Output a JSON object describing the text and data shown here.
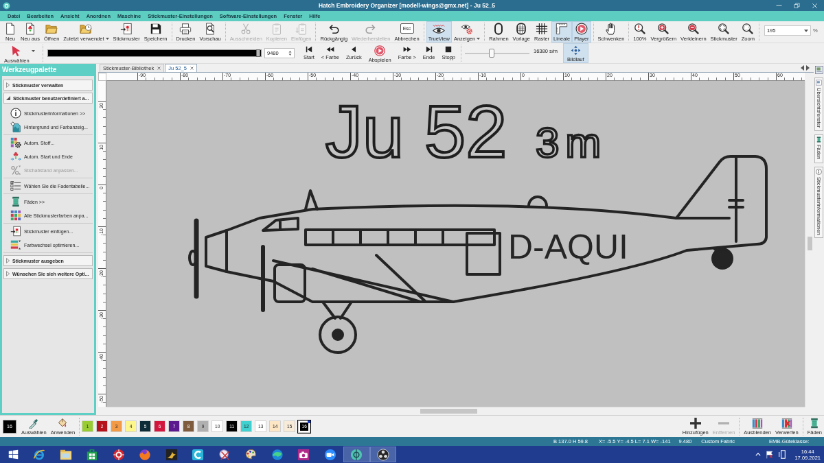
{
  "window": {
    "title": "Hatch Embroidery Organizer [modell-wings@gmx.net] - Ju 52_5"
  },
  "menu": [
    "Datei",
    "Bearbeiten",
    "Ansicht",
    "Anordnen",
    "Maschine",
    "Stickmuster-Einstellungen",
    "Software-Einstellungen",
    "Fenster",
    "Hilfe"
  ],
  "toolbar": {
    "groups": [
      {
        "buttons": [
          {
            "label": "Neu",
            "disabled": false,
            "on": false,
            "dropdown": false
          },
          {
            "label": "Neu aus",
            "disabled": false,
            "on": false,
            "dropdown": false
          },
          {
            "label": "Öffnen",
            "disabled": false,
            "on": false,
            "dropdown": false
          },
          {
            "label": "Zuletzt verwendet",
            "disabled": false,
            "on": false,
            "dropdown": true
          },
          {
            "label": "Stickmuster",
            "disabled": false,
            "on": false,
            "dropdown": false
          },
          {
            "label": "Speichern",
            "disabled": false,
            "on": false,
            "dropdown": false
          }
        ]
      },
      {
        "buttons": [
          {
            "label": "Drucken",
            "disabled": false,
            "on": false,
            "dropdown": false
          },
          {
            "label": "Vorschau",
            "disabled": false,
            "on": false,
            "dropdown": false
          }
        ]
      },
      {
        "buttons": [
          {
            "label": "Ausschneiden",
            "disabled": true,
            "on": false,
            "dropdown": false
          },
          {
            "label": "Kopieren",
            "disabled": true,
            "on": false,
            "dropdown": false
          },
          {
            "label": "Einfügen",
            "disabled": true,
            "on": false,
            "dropdown": false
          }
        ]
      },
      {
        "buttons": [
          {
            "label": "Rückgängig",
            "disabled": false,
            "on": false,
            "dropdown": false
          },
          {
            "label": "Wiederherstellen",
            "disabled": true,
            "on": false,
            "dropdown": false
          },
          {
            "label": "Abbrechen",
            "keycap": "Esc",
            "disabled": false,
            "on": false,
            "dropdown": false
          }
        ]
      },
      {
        "buttons": [
          {
            "label": "TrueView",
            "disabled": false,
            "on": true,
            "dropdown": false
          },
          {
            "label": "Anzeigen",
            "disabled": false,
            "on": false,
            "dropdown": true
          }
        ]
      },
      {
        "buttons": [
          {
            "label": "Rahmen",
            "disabled": false,
            "on": false,
            "dropdown": false
          },
          {
            "label": "Vorlage",
            "disabled": false,
            "on": false,
            "dropdown": false
          },
          {
            "label": "Raster",
            "disabled": false,
            "on": false,
            "dropdown": false
          },
          {
            "label": "Lineale",
            "disabled": false,
            "on": true,
            "dropdown": false
          },
          {
            "label": "Player",
            "disabled": false,
            "on": true,
            "dropdown": false
          }
        ]
      },
      {
        "buttons": [
          {
            "label": "Schwenken",
            "disabled": false,
            "on": false,
            "dropdown": false
          }
        ]
      },
      {
        "buttons": [
          {
            "label": "100%",
            "disabled": false,
            "on": false,
            "dropdown": false
          },
          {
            "label": "Vergrößern",
            "disabled": false,
            "on": false,
            "dropdown": false
          },
          {
            "label": "Verkleinern",
            "disabled": false,
            "on": false,
            "dropdown": false
          },
          {
            "label": "Stickmuster",
            "disabled": false,
            "on": false,
            "dropdown": false
          },
          {
            "label": "Zoom",
            "disabled": false,
            "on": false,
            "dropdown": false
          }
        ]
      }
    ],
    "zoom": {
      "value": "195",
      "unit": "%"
    }
  },
  "player_bar": {
    "select_tool": {
      "label": "Auswählen"
    },
    "stitch_slider": {
      "level": 1
    },
    "stitch_count": "9480",
    "controls": [
      "Start",
      "< Farbe",
      "Zurück",
      "Abspielen",
      "Farbe >",
      "Ende",
      "Stopp"
    ],
    "speed_slider": {
      "level": 0.41
    },
    "speed": "16380 s/m",
    "scroll_button": {
      "label": "Bildlauf",
      "on": true
    }
  },
  "tool_palette": {
    "title": "Werkzeugpalette",
    "sections": [
      {
        "label": "Stickmuster verwalten",
        "expanded": false
      },
      {
        "label": "Stickmuster benutzerdefiniert a...",
        "expanded": true,
        "groups": [
          {
            "items": [
              {
                "label": "Stickmusterinformationen >>",
                "disabled": false
              },
              {
                "label": "Hintergrund und Farbanzeig...",
                "disabled": false
              }
            ]
          },
          {
            "items": [
              {
                "label": "Autom. Stoff...",
                "disabled": false
              },
              {
                "label": "Autom. Start und Ende",
                "disabled": false
              },
              {
                "label": "Stichabstand anpassen...",
                "disabled": true
              }
            ]
          },
          {
            "items": [
              {
                "label": "Wählen Sie die Fadentabelle...",
                "disabled": false
              }
            ]
          },
          {
            "items": [
              {
                "label": "Fäden >>",
                "disabled": false
              },
              {
                "label": "Alle Stickmusterfarben anpa...",
                "disabled": false
              }
            ]
          },
          {
            "items": [
              {
                "label": "Stickmuster einfügen...",
                "disabled": false
              },
              {
                "label": "Farbwechsel optimieren...",
                "disabled": false
              }
            ]
          }
        ]
      },
      {
        "label": "Stickmuster ausgeben",
        "expanded": false
      },
      {
        "label": "Wünschen Sie sich weitere Opti...",
        "expanded": false
      }
    ]
  },
  "document_tabs": [
    {
      "label": "Stickmuster-Bibliothek",
      "selected": false
    },
    {
      "label": "Ju 52_5",
      "selected": true
    }
  ],
  "rulers": {
    "horizontal": [
      "-90",
      "-80",
      "-70",
      "-60",
      "-50",
      "-40",
      "-30",
      "-20",
      "-10",
      "0",
      "10",
      "20",
      "30",
      "40",
      "50",
      "60"
    ],
    "vertical": [
      "20",
      "10",
      "0",
      "-10",
      "-20",
      "-30",
      "-40",
      "-50"
    ]
  },
  "design": {
    "title": "Ju 52",
    "subtitle": "3m",
    "registration": "D-AQUI"
  },
  "side_tabs": [
    "Übersichtsfenster",
    "Fäden",
    "Stickmusterinformationen"
  ],
  "color_bar": {
    "current": "16",
    "tools": [
      "Auswählen",
      "Anwenden"
    ],
    "swatches": [
      {
        "label": "1",
        "color": "#99cc33",
        "selected": false
      },
      {
        "label": "2",
        "color": "#b5121b",
        "selected": false
      },
      {
        "label": "3",
        "color": "#f39a46",
        "selected": false
      },
      {
        "label": "4",
        "color": "#fdf68c",
        "selected": false
      },
      {
        "label": "5",
        "color": "#0e2c37",
        "selected": false
      },
      {
        "label": "6",
        "color": "#d3163e",
        "selected": false
      },
      {
        "label": "7",
        "color": "#5b1b8f",
        "selected": false
      },
      {
        "label": "8",
        "color": "#7d5b3c",
        "selected": false
      },
      {
        "label": "9",
        "color": "#b0b0b0",
        "selected": false
      },
      {
        "label": "10",
        "color": "#ffffff",
        "selected": false
      },
      {
        "label": "11",
        "color": "#000000",
        "selected": false
      },
      {
        "label": "12",
        "color": "#3fd0d0",
        "selected": false
      },
      {
        "label": "13",
        "color": "#ffffff",
        "selected": false
      },
      {
        "label": "14",
        "color": "#fde6c4",
        "selected": false
      },
      {
        "label": "15",
        "color": "#f8ecd9",
        "selected": false
      },
      {
        "label": "16",
        "color": "#000000",
        "selected": true
      }
    ],
    "actions": [
      {
        "label": "Hinzufügen",
        "disabled": false
      },
      {
        "label": "Entfernen",
        "disabled": true
      },
      {
        "label": "Ausblenden",
        "disabled": false
      },
      {
        "label": "Verwerfen",
        "disabled": false
      },
      {
        "label": "Fäden",
        "disabled": false
      }
    ]
  },
  "status_bar": [
    "B 137.0 H 59.8",
    "X= -5.5 Y= -4.5 L= 7.1 W= -141",
    "9.480",
    "Custom Fabric",
    "EMB-Güteklasse:"
  ],
  "taskbar": {
    "apps": [
      {
        "active": false
      },
      {
        "active": false
      },
      {
        "active": false
      },
      {
        "active": false
      },
      {
        "active": false
      },
      {
        "active": false
      },
      {
        "active": false
      },
      {
        "active": false
      },
      {
        "active": false
      },
      {
        "active": false
      },
      {
        "active": false
      },
      {
        "active": false
      },
      {
        "active": true
      },
      {
        "active": true
      }
    ],
    "time": "16:44",
    "date": "17.09.2021"
  }
}
